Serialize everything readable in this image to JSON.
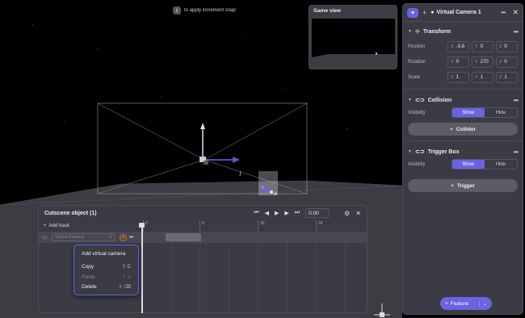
{
  "viewport": {
    "snap_hint": "to apply increment snap",
    "snap_key": "⇧"
  },
  "game_view": {
    "title": "Game view"
  },
  "inspector": {
    "title": "Virtual Camera 1",
    "transform": {
      "label": "Transform",
      "position": {
        "label": "Position",
        "x": "-3.8",
        "y": "0",
        "z": "0"
      },
      "rotation": {
        "label": "Rotation",
        "x": "0",
        "y": "270",
        "z": "0"
      },
      "scale": {
        "label": "Scale",
        "x": "1",
        "y": "1",
        "z": "1"
      }
    },
    "collision": {
      "label": "Collision",
      "visibility_label": "Visibility",
      "show": "Show",
      "hide": "Hide",
      "add_button": "Collider"
    },
    "trigger_box": {
      "label": "Trigger Box",
      "visibility_label": "Visibility",
      "show": "Show",
      "hide": "Hide",
      "add_button": "Trigger"
    },
    "feature_button": "Feature",
    "axis_x": "X",
    "axis_y": "Y",
    "axis_z": "Z"
  },
  "timeline": {
    "title": "Cutscene object (1)",
    "time_value": "0.00",
    "add_track": "Add track",
    "ruler": [
      "0",
      "8",
      "16",
      "24"
    ],
    "track_select": "Virtual Camera"
  },
  "context_menu": {
    "items": [
      {
        "label": "Add virtual camera",
        "shortcut": "",
        "disabled": false
      },
      {
        "label": "Copy",
        "shortcut": "⇧ C",
        "disabled": false
      },
      {
        "label": "Paste",
        "shortcut": "⇧ V",
        "disabled": true
      },
      {
        "label": "Delete",
        "shortcut": "⇧ ⌫",
        "disabled": false
      }
    ]
  },
  "colors": {
    "accent": "#6b63e0",
    "panel": "#3a3b44",
    "ground": "#3c3d42"
  }
}
